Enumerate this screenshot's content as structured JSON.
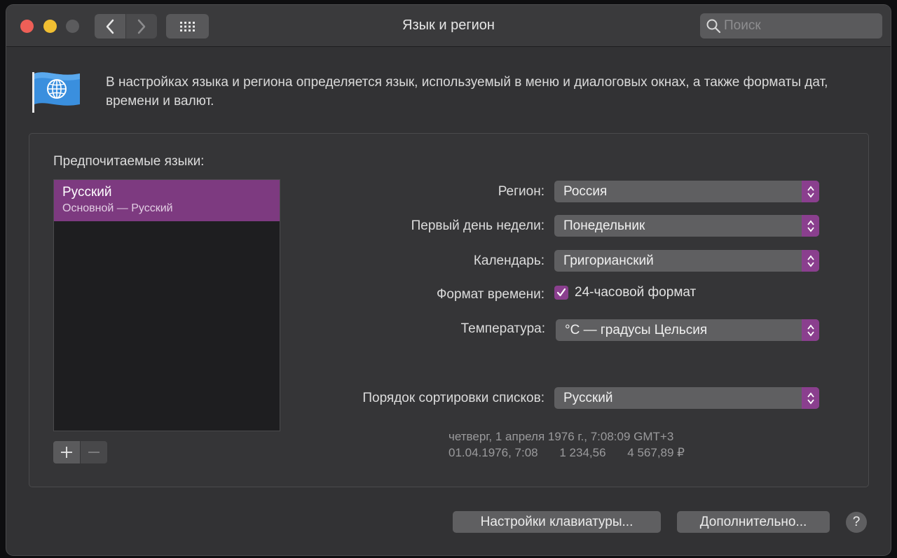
{
  "window": {
    "title": "Язык и регион"
  },
  "search": {
    "placeholder": "Поиск"
  },
  "description": "В настройках языка и региона определяется язык, используемый в меню и диалоговых окнах, а также форматы дат, времени и валют.",
  "preferred_languages": {
    "label": "Предпочитаемые языки:",
    "items": [
      {
        "name": "Русский",
        "subtitle": "Основной — Русский",
        "selected": true
      }
    ]
  },
  "settings": {
    "region": {
      "label": "Регион:",
      "value": "Россия"
    },
    "first_day": {
      "label": "Первый день недели:",
      "value": "Понедельник"
    },
    "calendar": {
      "label": "Календарь:",
      "value": "Григорианский"
    },
    "time_format": {
      "label": "Формат времени:",
      "checkbox_label": "24-часовой формат",
      "checked": true
    },
    "temperature": {
      "label": "Температура:",
      "value": "°C — градусы Цельсия"
    },
    "sort_order": {
      "label": "Порядок сортировки списков:",
      "value": "Русский"
    }
  },
  "sample": {
    "line1": "четверг, 1 апреля 1976 г., 7:08:09 GMT+3",
    "date_time": "01.04.1976, 7:08",
    "number": "1 234,56",
    "currency": "4 567,89 ₽"
  },
  "buttons": {
    "keyboard": "Настройки клавиатуры...",
    "advanced": "Дополнительно...",
    "help": "?"
  },
  "colors": {
    "accent": "#8a3f8e",
    "selection": "#7d3a80",
    "close": "#ee5f57",
    "minimize": "#f1bf32"
  }
}
